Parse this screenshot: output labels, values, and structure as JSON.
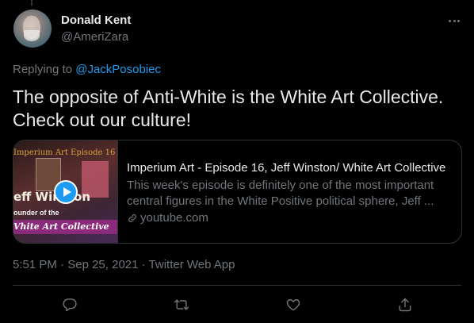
{
  "author": {
    "display_name": "Donald Kent",
    "handle": "@AmeriZara"
  },
  "reply": {
    "prefix": "Replying to",
    "mention": "@JackPosobiec"
  },
  "tweet": {
    "text_line1": "The opposite of Anti-White is the White Art Collective.",
    "text_line2": "Check out our culture!"
  },
  "card": {
    "thumb_top": "Imperium Art Episode 16",
    "thumb_mid": "eff Winston",
    "thumb_sub": "ounder of the",
    "thumb_bottom": "Vhite Art Collective",
    "title": "Imperium Art - Episode 16, Jeff Winston/ White Art Collective",
    "description": "This week's episode is definitely one of the most important central figures in the White Positive political sphere, Jeff ...",
    "domain": "youtube.com"
  },
  "meta": {
    "time": "5:51 PM",
    "sep1": " · ",
    "date": "Sep 25, 2021",
    "sep2": " · ",
    "source": "Twitter Web App"
  },
  "icons": {
    "more": "more-dots-icon",
    "reply": "reply-icon",
    "retweet": "retweet-icon",
    "like": "like-icon",
    "share": "share-icon",
    "link": "link-icon",
    "play": "play-icon"
  },
  "colors": {
    "background": "#000000",
    "text": "#e7e9ea",
    "secondary": "#71767b",
    "accent": "#1d9bf0",
    "border": "#2f3336"
  }
}
